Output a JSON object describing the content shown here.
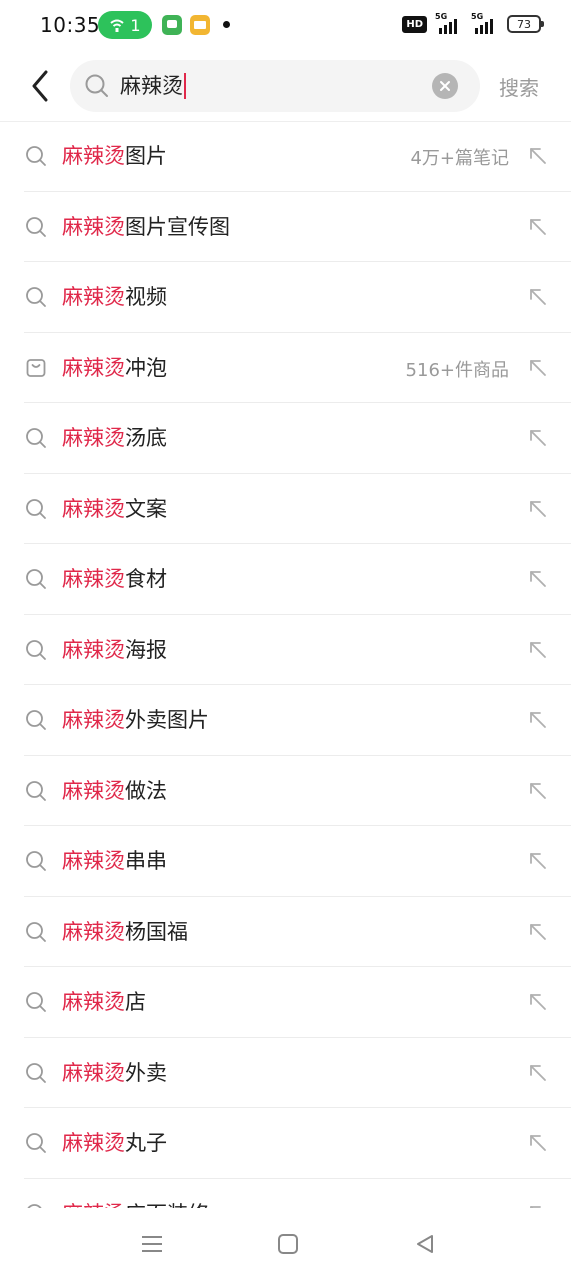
{
  "status_bar": {
    "time": "10:35",
    "hotspot_count": "1",
    "network_1": "5G",
    "network_2": "5G",
    "hd_label": "HD",
    "battery": "73"
  },
  "search": {
    "query": "麻辣烫",
    "submit_label": "搜索"
  },
  "suggestions": [
    {
      "icon": "search-icon",
      "highlight": "麻辣烫",
      "rest": "图片",
      "meta": "4万+篇笔记"
    },
    {
      "icon": "search-icon",
      "highlight": "麻辣烫",
      "rest": "图片宣传图",
      "meta": ""
    },
    {
      "icon": "search-icon",
      "highlight": "麻辣烫",
      "rest": "视频",
      "meta": ""
    },
    {
      "icon": "shopping-bag-icon",
      "highlight": "麻辣烫",
      "rest": "冲泡",
      "meta": "516+件商品"
    },
    {
      "icon": "search-icon",
      "highlight": "麻辣烫",
      "rest": "汤底",
      "meta": ""
    },
    {
      "icon": "search-icon",
      "highlight": "麻辣烫",
      "rest": "文案",
      "meta": ""
    },
    {
      "icon": "search-icon",
      "highlight": "麻辣烫",
      "rest": "食材",
      "meta": ""
    },
    {
      "icon": "search-icon",
      "highlight": "麻辣烫",
      "rest": "海报",
      "meta": ""
    },
    {
      "icon": "search-icon",
      "highlight": "麻辣烫",
      "rest": "外卖图片",
      "meta": ""
    },
    {
      "icon": "search-icon",
      "highlight": "麻辣烫",
      "rest": "做法",
      "meta": ""
    },
    {
      "icon": "search-icon",
      "highlight": "麻辣烫",
      "rest": "串串",
      "meta": ""
    },
    {
      "icon": "search-icon",
      "highlight": "麻辣烫",
      "rest": "杨国福",
      "meta": ""
    },
    {
      "icon": "search-icon",
      "highlight": "麻辣烫",
      "rest": "店",
      "meta": ""
    },
    {
      "icon": "search-icon",
      "highlight": "麻辣烫",
      "rest": "外卖",
      "meta": ""
    },
    {
      "icon": "search-icon",
      "highlight": "麻辣烫",
      "rest": "丸子",
      "meta": ""
    },
    {
      "icon": "search-icon",
      "highlight": "麻辣烫",
      "rest": "店面装修",
      "meta": ""
    }
  ],
  "colors": {
    "highlight": "#e0284a",
    "hotspot": "#2dc25b",
    "meta_text": "#9a9a9a"
  },
  "nav": [
    "menu-icon",
    "home-icon",
    "back-icon"
  ]
}
